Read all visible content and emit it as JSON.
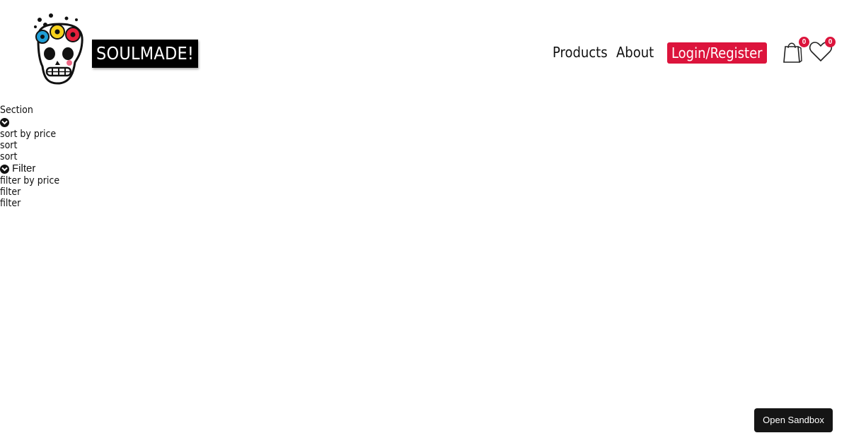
{
  "header": {
    "brand": "SOULMADE!",
    "logo_icon": "sugar-skull-icon",
    "nav": {
      "products": "Products",
      "about": "About",
      "login": "Login/Register"
    },
    "cart": {
      "icon": "shopping-bag-icon",
      "count": "0"
    },
    "wishlist": {
      "icon": "heart-icon",
      "count": "0"
    }
  },
  "controls": {
    "section_label": "Section",
    "sort_by_price": "sort by price",
    "sort_option_1": "sort",
    "sort_option_2": "sort",
    "filter_label": "Filter",
    "filter_by_price": "filter by price",
    "filter_option_1": "filter",
    "filter_option_2": "filter"
  },
  "sandbox": {
    "label": "Open Sandbox"
  },
  "colors": {
    "accent": "#dc143c",
    "brand_bg": "#000000",
    "sandbox_bg": "#151515"
  }
}
